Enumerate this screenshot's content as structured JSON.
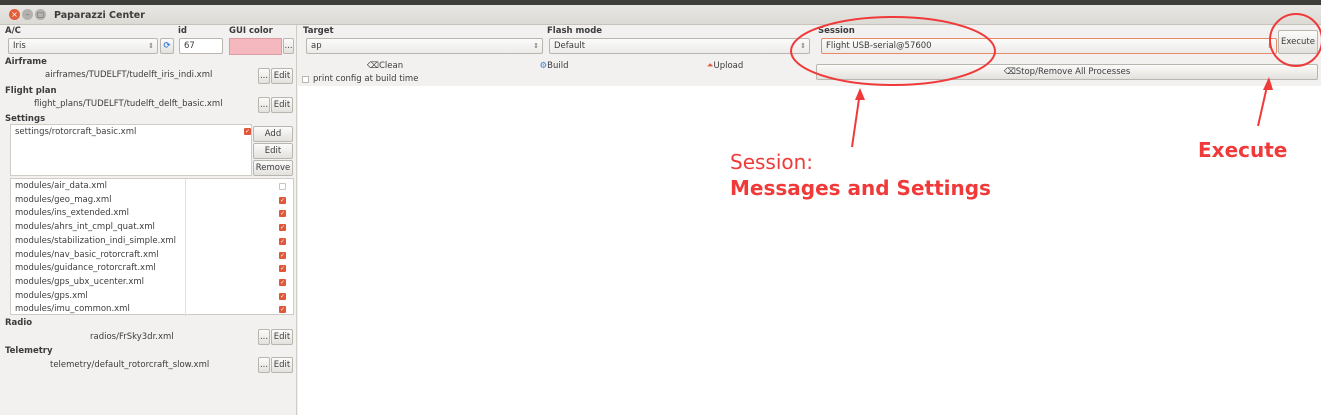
{
  "window": {
    "title": "Paparazzi Center"
  },
  "ac": {
    "label": "A/C",
    "value": "Iris",
    "id_label": "id",
    "id_value": "67",
    "gui_color_label": "GUI color",
    "gui_color": "#f4b8be",
    "more": "..."
  },
  "airframe": {
    "label": "Airframe",
    "file": "airframes/TUDELFT/tudelft_iris_indi.xml",
    "more": "...",
    "edit": "Edit"
  },
  "flight_plan": {
    "label": "Flight plan",
    "file": "flight_plans/TUDELFT/tudelft_delft_basic.xml",
    "more": "...",
    "edit": "Edit"
  },
  "settings": {
    "label": "Settings",
    "file": "settings/rotorcraft_basic.xml",
    "add": "Add",
    "edit": "Edit",
    "remove": "Remove"
  },
  "modules": [
    {
      "name": "modules/air_data.xml",
      "checked": false
    },
    {
      "name": "modules/geo_mag.xml",
      "checked": true
    },
    {
      "name": "modules/ins_extended.xml",
      "checked": true
    },
    {
      "name": "modules/ahrs_int_cmpl_quat.xml",
      "checked": true
    },
    {
      "name": "modules/stabilization_indi_simple.xml",
      "checked": true
    },
    {
      "name": "modules/nav_basic_rotorcraft.xml",
      "checked": true
    },
    {
      "name": "modules/guidance_rotorcraft.xml",
      "checked": true
    },
    {
      "name": "modules/gps_ubx_ucenter.xml",
      "checked": true
    },
    {
      "name": "modules/gps.xml",
      "checked": true
    },
    {
      "name": "modules/imu_common.xml",
      "checked": true
    }
  ],
  "radio": {
    "label": "Radio",
    "file": "radios/FrSky3dr.xml",
    "more": "...",
    "edit": "Edit"
  },
  "telemetry": {
    "label": "Telemetry",
    "file": "telemetry/default_rotorcraft_slow.xml",
    "more": "...",
    "edit": "Edit"
  },
  "target": {
    "label": "Target",
    "value": "ap"
  },
  "flash_mode": {
    "label": "Flash mode",
    "value": "Default"
  },
  "session": {
    "label": "Session",
    "value": "Flight USB-serial@57600"
  },
  "buttons": {
    "clean": "Clean",
    "build": "Build",
    "upload": "Upload",
    "execute": "Execute",
    "stop_all": "Stop/Remove All Processes"
  },
  "print_config": "print config at build time",
  "annotations": {
    "session_line1": "Session:",
    "session_line2": "Messages and Settings",
    "execute": "Execute",
    "color": "#f03a3a"
  }
}
